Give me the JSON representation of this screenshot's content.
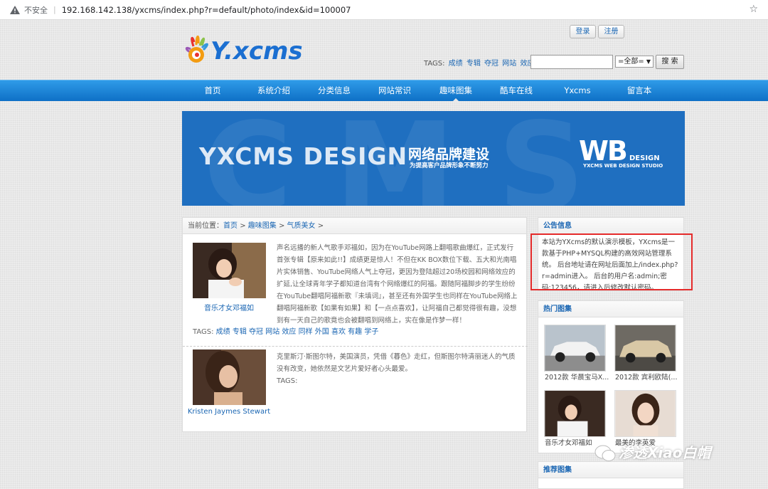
{
  "browser": {
    "security_label": "不安全",
    "url": "192.168.142.138/yxcms/index.php?r=default/photo/index&id=100007"
  },
  "header": {
    "logo_text": "Y.xcms",
    "login_label": "登录",
    "register_label": "注册",
    "tags_prefix": "TAGS:",
    "tags": [
      "成绩",
      "专辑",
      "夺冠",
      "网站",
      "效应"
    ],
    "tags_more": "...",
    "search_placeholder": "",
    "select_value": "=全部=",
    "search_button": "搜 索"
  },
  "nav": {
    "items": [
      "首页",
      "系统介绍",
      "分类信息",
      "网站常识",
      "趣味图集",
      "酷车在线",
      "Yxcms",
      "留言本"
    ],
    "active": "趣味图集"
  },
  "banner": {
    "bg_letters": "CMS",
    "title": "YXCMS DESIGN",
    "title_cn": "网络品牌建设",
    "subtitle_cn": "为提高客户品牌形象不断努力",
    "wb": "WB",
    "design": "DESIGN",
    "studio": "YXCMS WEB DESIGN STUDIO"
  },
  "main": {
    "crumb_prefix": "当前位置：",
    "crumbs": [
      "首页",
      "趣味图集",
      "气质美女"
    ],
    "crumb_sep": ">",
    "entries": [
      {
        "caption": "音乐才女邓福如",
        "text": "声名远播的新人气歌手邓福如，因为在YouTube网路上翻唱歌曲爆红，正式发行首张专辑【原来如此!!】成绩更是惊人！不但在KK BOX数位下载、五大和光南唱片实体销售、YouTube网络人气上夺冠，更因为登陆超过20场校园和网络效应的扩延,让全球青年学子都知道台湾有个网络爆红的阿福。跟随阿福脚步的学生纷纷在YouTube翻唱阿福新歌『未填词』，甚至还有外国学生也同样在YouTube网络上翻唱阿福新歌【如果有如果】和【一点点喜欢】，让阿福自己都觉得很有趣，没想到有一天自己的歌竟也会被翻唱到网络上，实在像是作梦一样！",
        "tags_prefix": "TAGS:",
        "tags": [
          "成绩",
          "专辑",
          "夺冠",
          "网站",
          "效应",
          "同样",
          "外国",
          "喜欢",
          "有趣",
          "学子"
        ]
      },
      {
        "caption": "Kristen Jaymes Stewart",
        "text": "克里斯汀·斯图尔特，美国演员，凭借《暮色》走红，但斯图尔特清丽迷人的气质没有改变，她依然是文艺片爱好者心头最爱。",
        "tags_prefix": "TAGS:",
        "tags": []
      }
    ]
  },
  "sidebar": {
    "notice_title": "公告信息",
    "notice_text": "本站为YXcms的默认演示模板，YXcms是一款基于PHP+MYSQL构建的高效网站管理系统。 后台地址请在网址后面加上/index.php?r=admin进入。 后台的用户名:admin;密码:123456，请进入后修改默认密码。",
    "hot_title": "热门图集",
    "hot_items": [
      "2012款 华晨宝马X...",
      "2012款 宾利欧陆(...",
      "音乐才女邓福如",
      "最美的李英爱"
    ],
    "recommend_title": "推荐图集"
  },
  "watermark": "渗透Xiao白帽",
  "colors": {
    "nav_blue": "#1a7fd4",
    "link_blue": "#1a66b3",
    "highlight_red": "#e52b2b"
  }
}
